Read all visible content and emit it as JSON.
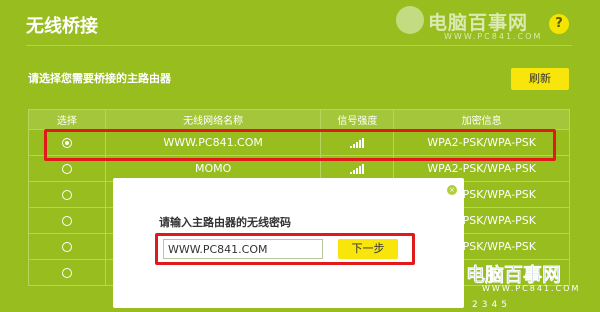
{
  "page": {
    "title": "无线桥接",
    "help_icon": "?",
    "help_icon_name": "help-icon"
  },
  "watermark_top": {
    "text": "电脑百事网",
    "subtext": "WWW.PC841.COM"
  },
  "section": {
    "label": "请选择您需要桥接的主路由器",
    "refresh_label": "刷新"
  },
  "table": {
    "headers": [
      "选择",
      "无线网络名称",
      "信号强度",
      "加密信息"
    ],
    "rows": [
      {
        "selected": true,
        "ssid": "WWW.PC841.COM",
        "signal": 5,
        "encryption": "WPA2-PSK/WPA-PSK"
      },
      {
        "selected": false,
        "ssid": "MOMO",
        "signal": 5,
        "encryption": "WPA2-PSK/WPA-PSK"
      },
      {
        "selected": false,
        "ssid": "",
        "signal": 0,
        "encryption": "WPA2-PSK/WPA-PSK"
      },
      {
        "selected": false,
        "ssid": "",
        "signal": 0,
        "encryption": "WPA2-PSK/WPA-PSK"
      },
      {
        "selected": false,
        "ssid": "",
        "signal": 0,
        "encryption": "WPA2-PSK/WPA-PSK"
      },
      {
        "selected": false,
        "ssid": "",
        "signal": 0,
        "encryption": ""
      }
    ]
  },
  "modal": {
    "prompt": "请输入主路由器的无线密码",
    "password_value": "WWW.PC841.COM",
    "next_label": "下一步",
    "close_icon": "×"
  },
  "watermark_bottom": {
    "text": "电脑百事网",
    "subtext": "WWW.PC841.COM"
  },
  "pager": {
    "pages": [
      "2",
      "3",
      "4",
      "5"
    ]
  },
  "colors": {
    "background": "#97bd1f",
    "accent_button": "#f7e50b",
    "highlight_border": "#e01a1a"
  }
}
